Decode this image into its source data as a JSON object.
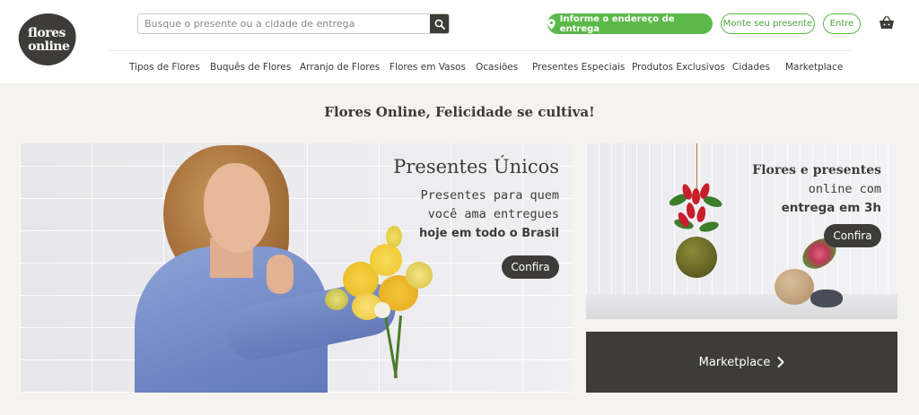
{
  "header": {
    "logo": {
      "line1": "flores",
      "line2": "online"
    },
    "search": {
      "placeholder": "Busque o presente ou a cidade de entrega",
      "value": ""
    },
    "location_button": "Informe o endereço de entrega",
    "build_gift_button": "Monte seu presente",
    "login_button": "Entre",
    "colors": {
      "accent_green": "#5bb94a",
      "dark": "#3d3c38"
    }
  },
  "nav": {
    "items": [
      "Tipos de Flores",
      "Buquês de Flores",
      "Arranjo de Flores",
      "Flores em Vasos",
      "Ocasiões",
      "Presentes Especiais",
      "Produtos Exclusivos",
      "Cidades",
      "Marketplace"
    ]
  },
  "main": {
    "tagline": "Flores Online, Felicidade se cultiva!",
    "hero": {
      "title": "Presentes Únicos",
      "line1": "Presentes para quem",
      "line2": "você ama entregues",
      "line3": "hoje em todo o Brasil",
      "cta": "Confira"
    },
    "side_banner": {
      "line1": "Flores e presentes",
      "line2": "online com",
      "line3": "entrega em 3h",
      "cta": "Confira"
    },
    "marketplace_banner": {
      "label": "Marketplace"
    }
  }
}
